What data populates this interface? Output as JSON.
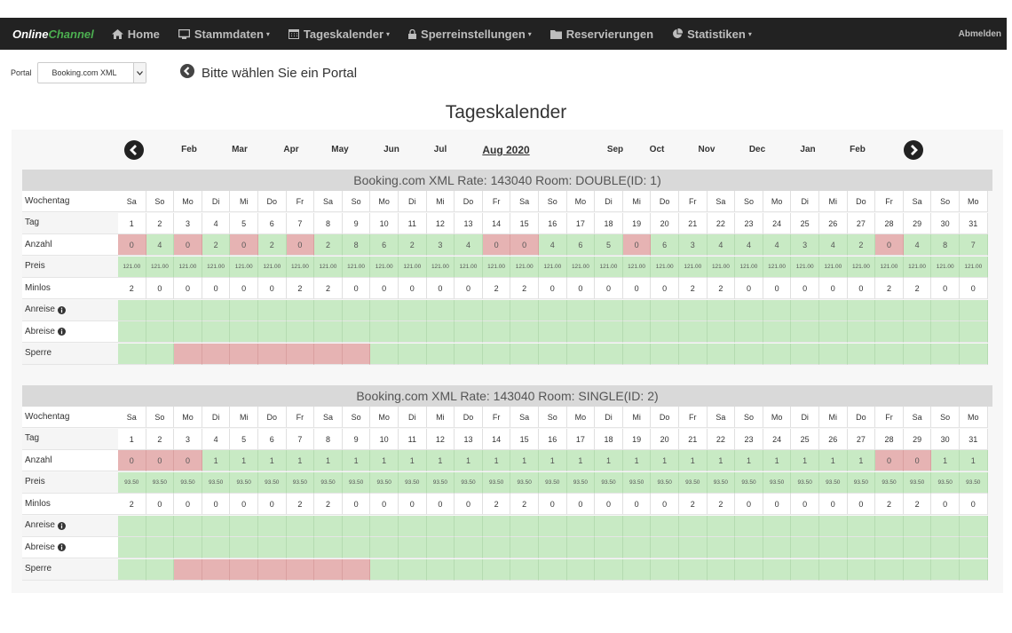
{
  "navbar": {
    "brand_part1": "Online",
    "brand_part2": "Channel",
    "items": [
      {
        "label": "Home",
        "icon": "home-icon",
        "dropdown": false
      },
      {
        "label": "Stammdaten",
        "icon": "monitor-icon",
        "dropdown": true
      },
      {
        "label": "Tageskalender",
        "icon": "calendar-icon",
        "dropdown": true
      },
      {
        "label": "Sperreinstellungen",
        "icon": "lock-icon",
        "dropdown": true
      },
      {
        "label": "Reservierungen",
        "icon": "folder-icon",
        "dropdown": false
      },
      {
        "label": "Statistiken",
        "icon": "pie-chart-icon",
        "dropdown": true
      }
    ],
    "logout": "Abmelden"
  },
  "portal": {
    "label": "Portal",
    "selected": "Booking.com XML",
    "hint": "Bitte wählen Sie ein Portal"
  },
  "page_title": "Tageskalender",
  "months": [
    "Feb",
    "Mar",
    "Apr",
    "May",
    "Jun",
    "Jul",
    "Aug 2020",
    "Sep",
    "Oct",
    "Nov",
    "Dec",
    "Jan",
    "Feb"
  ],
  "active_month_index": 6,
  "colors": {
    "available": "#c8eac4",
    "blocked": "#e6b3b3",
    "navbar": "#222222",
    "brand_accent": "#4caf50"
  },
  "row_labels": {
    "weekday": "Wochentag",
    "day": "Tag",
    "count": "Anzahl",
    "price": "Preis",
    "minlos": "Minlos",
    "arrival": "Anreise",
    "departure": "Abreise",
    "block": "Sperre"
  },
  "weekdays": [
    "Sa",
    "So",
    "Mo",
    "Di",
    "Mi",
    "Do",
    "Fr",
    "Sa",
    "So",
    "Mo",
    "Di",
    "Mi",
    "Do",
    "Fr",
    "Sa",
    "So",
    "Mo",
    "Di",
    "Mi",
    "Do",
    "Fr",
    "Sa",
    "So",
    "Mo",
    "Di",
    "Mi",
    "Do",
    "Fr",
    "Sa",
    "So",
    "Mo"
  ],
  "days": [
    "1",
    "2",
    "3",
    "4",
    "5",
    "6",
    "7",
    "8",
    "9",
    "10",
    "11",
    "12",
    "13",
    "14",
    "15",
    "16",
    "17",
    "18",
    "19",
    "20",
    "21",
    "22",
    "23",
    "24",
    "25",
    "26",
    "27",
    "28",
    "29",
    "30",
    "31"
  ],
  "rooms": [
    {
      "title": "Booking.com XML Rate: 143040 Room: DOUBLE(ID: 1)",
      "anzahl": [
        "0",
        "4",
        "0",
        "2",
        "0",
        "2",
        "0",
        "2",
        "8",
        "6",
        "2",
        "3",
        "4",
        "0",
        "0",
        "4",
        "6",
        "5",
        "0",
        "6",
        "3",
        "4",
        "4",
        "4",
        "3",
        "4",
        "2",
        "0",
        "4",
        "8",
        "7"
      ],
      "preis": [
        "121.00",
        "121.00",
        "121.00",
        "121.00",
        "121.00",
        "121.00",
        "121.00",
        "121.00",
        "121.00",
        "121.00",
        "121.00",
        "121.00",
        "121.00",
        "121.00",
        "121.00",
        "121.00",
        "121.00",
        "121.00",
        "121.00",
        "121.00",
        "121.00",
        "121.00",
        "121.00",
        "121.00",
        "121.00",
        "121.00",
        "121.00",
        "121.00",
        "121.00",
        "121.00",
        "121.00"
      ],
      "minlos": [
        "2",
        "0",
        "0",
        "0",
        "0",
        "0",
        "2",
        "2",
        "0",
        "0",
        "0",
        "0",
        "0",
        "2",
        "2",
        "0",
        "0",
        "0",
        "0",
        "0",
        "2",
        "2",
        "0",
        "0",
        "0",
        "0",
        "0",
        "2",
        "2",
        "0",
        "0"
      ],
      "sperre_blocked_days": [
        3,
        4,
        5,
        6,
        7,
        8,
        9
      ]
    },
    {
      "title": "Booking.com XML Rate: 143040 Room: SINGLE(ID: 2)",
      "anzahl": [
        "0",
        "0",
        "0",
        "1",
        "1",
        "1",
        "1",
        "1",
        "1",
        "1",
        "1",
        "1",
        "1",
        "1",
        "1",
        "1",
        "1",
        "1",
        "1",
        "1",
        "1",
        "1",
        "1",
        "1",
        "1",
        "1",
        "1",
        "0",
        "0",
        "1",
        "1"
      ],
      "preis": [
        "93.50",
        "93.50",
        "93.50",
        "93.50",
        "93.50",
        "93.50",
        "93.50",
        "93.50",
        "93.50",
        "93.50",
        "93.50",
        "93.50",
        "93.50",
        "93.50",
        "93.50",
        "93.50",
        "93.50",
        "93.50",
        "93.50",
        "93.50",
        "93.50",
        "93.50",
        "93.50",
        "93.50",
        "93.50",
        "93.50",
        "93.50",
        "93.50",
        "93.50",
        "93.50",
        "93.50"
      ],
      "minlos": [
        "2",
        "0",
        "0",
        "0",
        "0",
        "0",
        "2",
        "2",
        "0",
        "0",
        "0",
        "0",
        "0",
        "2",
        "2",
        "0",
        "0",
        "0",
        "0",
        "0",
        "2",
        "2",
        "0",
        "0",
        "0",
        "0",
        "0",
        "2",
        "2",
        "0",
        "0"
      ],
      "sperre_blocked_days": [
        3,
        4,
        5,
        6,
        7,
        8,
        9
      ]
    }
  ]
}
